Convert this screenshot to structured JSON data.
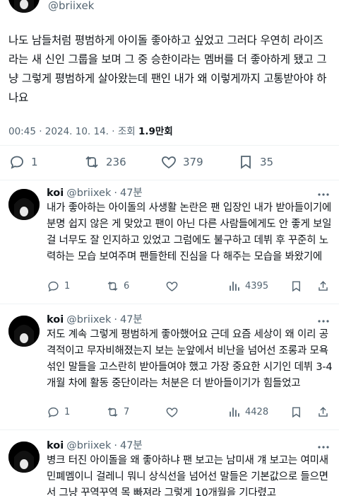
{
  "main_post": {
    "handle": "@briixek",
    "text": "나도 남들처럼 평범하게 아이돌 좋아하고 싶었고 그러다 우연히 라이즈라는 새 신인 그룹을 보며 그 중 승한이라는 멤버를 더 좋아하게 됐고 그냥 그렇게 평범하게 살아왔는데 팬인 내가 왜 이렇게까지 고통받아야 하나요",
    "time": "00:45",
    "date": "2024. 10. 14.",
    "views_label": "조회",
    "views_count": "1.9만회",
    "replies": "1",
    "reposts": "236",
    "likes": "379",
    "bookmarks": "35"
  },
  "replies": [
    {
      "name": "koi",
      "handle": "@briixek",
      "time": "47분",
      "text": "내가 좋아하는 아이돌의 사생활 논란은 팬 입장인 내가 받아들이기에 분명 쉽지 않은 게 맞았고 팬이 아닌 다른 사람들에게도 안 좋게 보일 걸 너무도 잘 인지하고 있었고 그럼에도 불구하고 데뷔 후 꾸준히 노력하는 모습 보여주며 팬들한테 진심을 다 해주는 모습을 봐왔기에",
      "replies": "1",
      "reposts": "6",
      "likes": "",
      "views": "4395"
    },
    {
      "name": "koi",
      "handle": "@briixek",
      "time": "47분",
      "text": "저도 계속 그렇게 평범하게 좋아했어요 근데 요즘 세상이 왜 이리 공격적이고 무자비해졌는지 보는 눈앞에서 비난을 넘어선 조롱과 모욕섞인 말들을 고스란히 받아들여야 했고 가장 중요한 시기인 데뷔 3-4개월 차에 활동 중단이라는 처분은 더 받아들이기가 힘들었고",
      "replies": "1",
      "reposts": "7",
      "likes": "",
      "views": "4428"
    },
    {
      "name": "koi",
      "handle": "@briixek",
      "time": "47분",
      "text": "병크 터진 아이돌을 왜 좋아하냐 팬 보고는 남미새 걔 보고는 여미새 민폐멤이니 걸레니 뭐니 상식선을 넘어선 말들은 기본값으로 들으면서 그냥 꾸역꾸역 목 빠져라 그렇게 10개월을 기다렸고"
    }
  ],
  "icons": {
    "reply": "speech-bubble-icon",
    "repost": "repost-arrows-icon",
    "like": "heart-icon",
    "bookmark": "bookmark-icon",
    "views": "views-bar-chart-icon",
    "more": "ellipsis-icon"
  },
  "colors": {
    "text": "#0f1419",
    "secondary": "#536471",
    "divider": "#eff3f4"
  }
}
